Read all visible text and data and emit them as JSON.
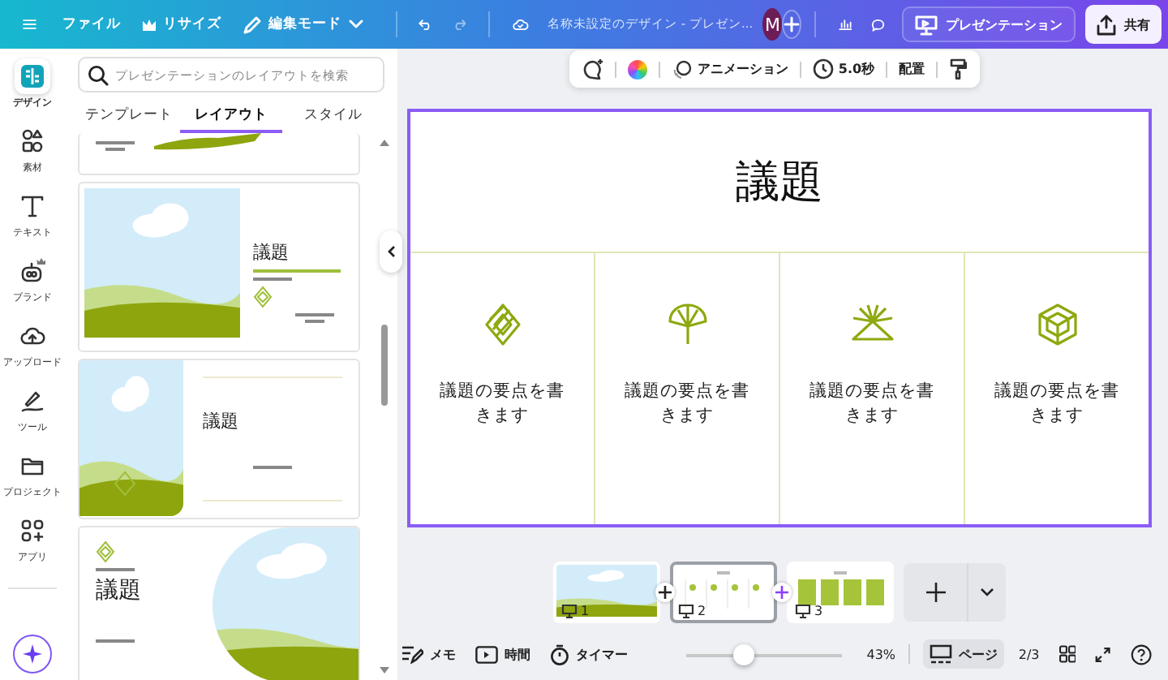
{
  "topbar": {
    "menu": [
      {
        "label": "ファイル",
        "kind": "plain"
      },
      {
        "label": "リサイズ",
        "kind": "crown"
      },
      {
        "label": "編集モード",
        "kind": "pencil"
      }
    ],
    "title": "名称未設定のデザイン - プレゼン...",
    "avatar": "M",
    "present": "プレゼンテーション",
    "share": "共有"
  },
  "rail": [
    {
      "label": "デザイン",
      "kind": "design",
      "selected": true
    },
    {
      "label": "素材",
      "kind": "elements",
      "selected": false
    },
    {
      "label": "テキスト",
      "kind": "text",
      "selected": false
    },
    {
      "label": "ブランド",
      "kind": "brand",
      "selected": false
    },
    {
      "label": "アップロード",
      "kind": "upload",
      "selected": false
    },
    {
      "label": "ツール",
      "kind": "tools",
      "selected": false
    },
    {
      "label": "プロジェクト",
      "kind": "folder",
      "selected": false
    },
    {
      "label": "アプリ",
      "kind": "apps",
      "selected": false
    }
  ],
  "panel": {
    "search": {
      "placeholder": "プレゼンテーションのレイアウトを検索"
    },
    "tabs": [
      {
        "label": "テンプレート",
        "selected": false
      },
      {
        "label": "レイアウト",
        "selected": true
      },
      {
        "label": "スタイル",
        "selected": false
      }
    ],
    "layouts": [
      {
        "kind": "cut"
      },
      {
        "kind": "photo-left",
        "title": "議題"
      },
      {
        "kind": "photo-rounded",
        "title": "議題"
      },
      {
        "kind": "circle-right",
        "title": "議題"
      }
    ]
  },
  "toolbar": {
    "animation": "アニメーション",
    "duration": "5.0秒",
    "arrange": "配置"
  },
  "slide": {
    "title": "議題",
    "points": [
      {
        "kind": "diamond",
        "text": "議題の要点を書きます"
      },
      {
        "kind": "ginkgo",
        "text": "議題の要点を書きます"
      },
      {
        "kind": "fan",
        "text": "議題の要点を書きます"
      },
      {
        "kind": "hexagon",
        "text": "議題の要点を書きます"
      }
    ]
  },
  "pages": [
    {
      "number": "1",
      "kind": "photo",
      "selected": false
    },
    {
      "number": "2",
      "kind": "columns",
      "selected": true
    },
    {
      "number": "3",
      "kind": "blocks",
      "selected": false
    }
  ],
  "bottom": {
    "notes": "メモ",
    "timing": "時間",
    "timer": "タイマー",
    "zoom": {
      "level": 0.38
    },
    "zoom_reading": "43%",
    "pages_button": "ページ",
    "page_count": "2/3"
  }
}
